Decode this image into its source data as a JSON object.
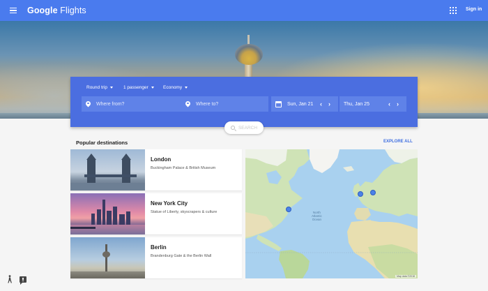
{
  "app": {
    "brand_google": "Google",
    "brand_product": "Flights",
    "sign_in_label": "Sign in"
  },
  "icons": {
    "menu": "menu-icon",
    "apps": "apps-grid-icon",
    "origin": "location-pin-icon",
    "destination": "location-pin-icon",
    "swap": "swap-icon",
    "calendar": "calendar-icon",
    "search": "search-icon",
    "figure": "accessibility-figure-icon",
    "feedback": "feedback-icon"
  },
  "search": {
    "trip_type": "Round trip",
    "passengers": "1 passenger",
    "cabin_class": "Economy",
    "origin_placeholder": "Where from?",
    "destination_placeholder": "Where to?",
    "depart_date": "Sun, Jan 21",
    "return_date": "Thu, Jan 25",
    "prev_glyph": "‹",
    "next_glyph": "›",
    "swap_glyph": "⇄",
    "search_label": "SEARCH"
  },
  "popular": {
    "title": "Popular destinations",
    "explore_label": "EXPLORE ALL",
    "destinations": [
      {
        "name": "London",
        "subtitle": "Buckingham Palace & British Museum"
      },
      {
        "name": "New York City",
        "subtitle": "Statue of Liberty, skyscrapers & culture"
      },
      {
        "name": "Berlin",
        "subtitle": "Brandenburg Gate & the Berlin Wall"
      }
    ]
  },
  "map": {
    "ocean_label_line1": "North",
    "ocean_label_line2": "Atlantic",
    "ocean_label_line3": "Ocean",
    "copyright": "Map data ©2018"
  },
  "colors": {
    "app_bar": "#4a7bee",
    "search_panel": "#4b6ee0",
    "search_field": "#5f82e8",
    "accent_link": "#3f6ee0",
    "map_marker": "#4b82e8"
  }
}
